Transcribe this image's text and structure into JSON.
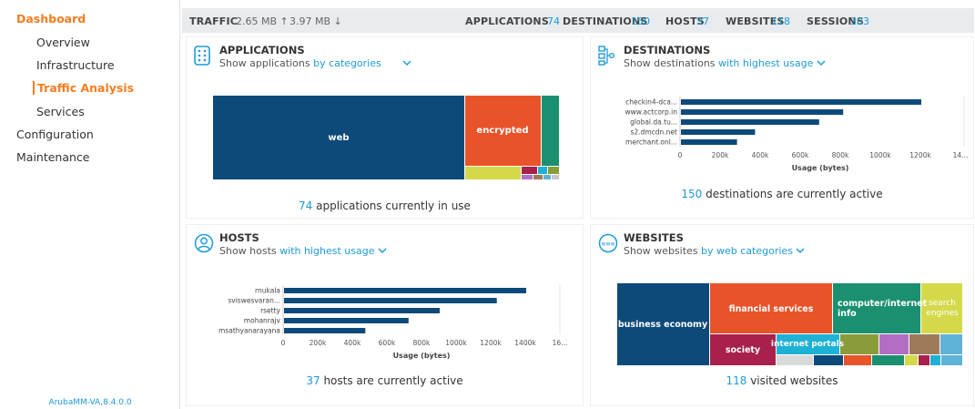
{
  "sidebar": {
    "items": [
      {
        "label": "Dashboard"
      },
      {
        "label": "Overview"
      },
      {
        "label": "Infrastructure"
      },
      {
        "label": "Traffic Analysis"
      },
      {
        "label": "Services"
      },
      {
        "label": "Configuration"
      },
      {
        "label": "Maintenance"
      }
    ],
    "version": "ArubaMM-VA,8.4.0.0"
  },
  "statsbar": {
    "traffic_label": "TRAFFIC",
    "traffic_up": "2.65 MB ↑",
    "traffic_down": "3.97 MB ↓",
    "applications_label": "APPLICATIONS",
    "applications_value": "74",
    "destinations_label": "DESTINATIONS",
    "destinations_value": "150",
    "hosts_label": "HOSTS",
    "hosts_value": "37",
    "websites_label": "WEBSITES",
    "websites_value": "118",
    "sessions_label": "SESSIONS",
    "sessions_value": "303"
  },
  "applications": {
    "title": "APPLICATIONS",
    "subtitle_prefix": "Show applications",
    "subtitle_link": "by categories",
    "footer_num": "74",
    "footer_text": " applications currently in use"
  },
  "destinations": {
    "title": "DESTINATIONS",
    "subtitle_prefix": "Show destinations",
    "subtitle_link": "with highest usage",
    "footer_num": "150",
    "footer_text": " destinations are currently active"
  },
  "hosts": {
    "title": "HOSTS",
    "subtitle_prefix": "Show hosts",
    "subtitle_link": "with highest usage",
    "footer_num": "37",
    "footer_text": " hosts are currently active"
  },
  "websites": {
    "title": "WEBSITES",
    "subtitle_prefix": "Show websites",
    "subtitle_link": "by web categories",
    "footer_num": "118",
    "footer_text": " visited websites"
  },
  "colors": {
    "accent": "#1e9bd7",
    "brand_orange": "#f47d20",
    "bar_navy": "#0d4a7a"
  },
  "icons": {
    "applications": "apps-grid-icon",
    "destinations": "network-nodes-icon",
    "hosts": "user-circle-icon",
    "websites": "www-globe-icon",
    "dropdown": "chevron-down-icon"
  },
  "chart_data": [
    {
      "type": "treemap",
      "categories": [
        "web",
        "encrypted"
      ],
      "values": [
        300,
        70
      ],
      "extra_small_tiles": 10
    },
    {
      "type": "bar",
      "orientation": "horizontal",
      "categories": [
        "checkin4-dca...",
        "www.actcorp.in",
        "global.da.tu...",
        "s2.dmcdn.net",
        "merchant.onl..."
      ],
      "values": [
        1200000,
        810000,
        690000,
        370000,
        280000
      ],
      "xlabel": "Usage (bytes)",
      "xticks": [
        "0",
        "200k",
        "400k",
        "600k",
        "800k",
        "1000k",
        "1200k",
        "14..."
      ],
      "xlim": [
        0,
        1400000
      ]
    },
    {
      "type": "bar",
      "orientation": "horizontal",
      "categories": [
        "rnukala",
        "sviswesvaran...",
        "rsetty",
        "mohanrajv",
        "msathyanarayana"
      ],
      "values": [
        1400000,
        1230000,
        900000,
        720000,
        470000
      ],
      "xlabel": "Usage (bytes)",
      "xticks": [
        "0",
        "200k",
        "400k",
        "600k",
        "800k",
        "1000k",
        "1200k",
        "1400k",
        "16..."
      ],
      "xlim": [
        0,
        1600000
      ]
    },
    {
      "type": "treemap",
      "categories": [
        "business economy",
        "financial services",
        "computer/internet info",
        "search engines",
        "society",
        "internet portals"
      ],
      "values": [
        100,
        130,
        95,
        45,
        70,
        70
      ],
      "extra_small_tiles": 13
    }
  ]
}
